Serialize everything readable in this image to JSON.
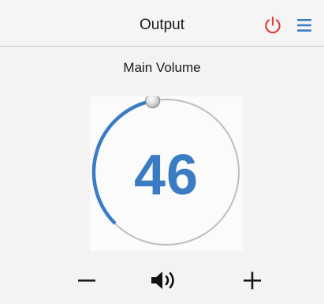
{
  "header": {
    "title": "Output",
    "power_color": "#d9403a",
    "menu_color": "#3a7cc4"
  },
  "main": {
    "label": "Main Volume"
  },
  "volume": {
    "value": "46",
    "level": 0.46,
    "accent_color": "#3a7cc4"
  },
  "controls": {
    "decrease_icon": "minus-icon",
    "mute_icon": "speaker-icon",
    "increase_icon": "plus-icon"
  }
}
